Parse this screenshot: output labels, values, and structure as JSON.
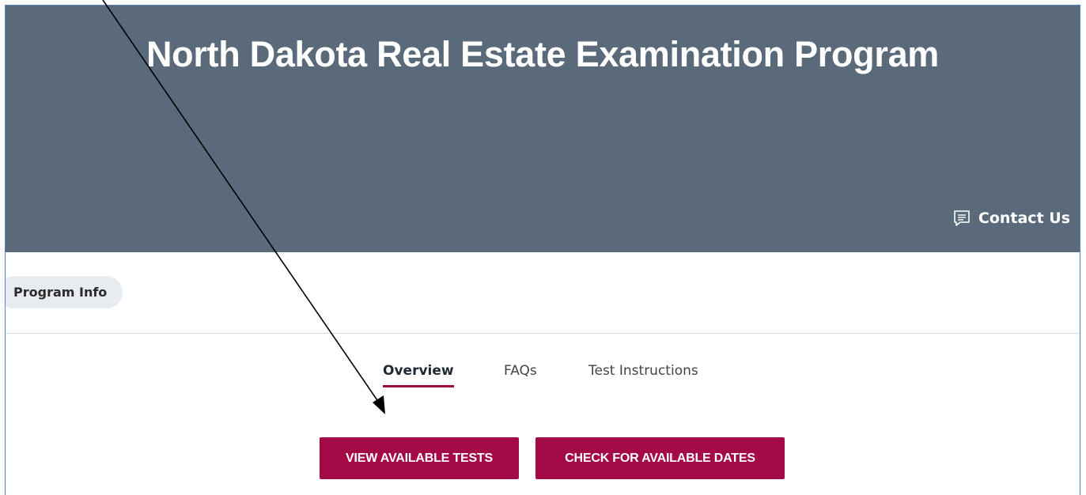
{
  "header": {
    "title": "North Dakota Real Estate Examination Program",
    "contact_label": "Contact Us",
    "contact_icon": "message-icon",
    "background_color": "#5a6a7a"
  },
  "program_info": {
    "label": "Program Info"
  },
  "tabs": [
    {
      "label": "Overview",
      "active": true
    },
    {
      "label": "FAQs",
      "active": false
    },
    {
      "label": "Test Instructions",
      "active": false
    }
  ],
  "buttons": {
    "view_tests": "VIEW AVAILABLE TESTS",
    "check_dates": "CHECK FOR AVAILABLE DATES",
    "color": "#a30a47"
  },
  "annotation": {
    "type": "arrow",
    "points_to": "view-available-tests-button"
  }
}
